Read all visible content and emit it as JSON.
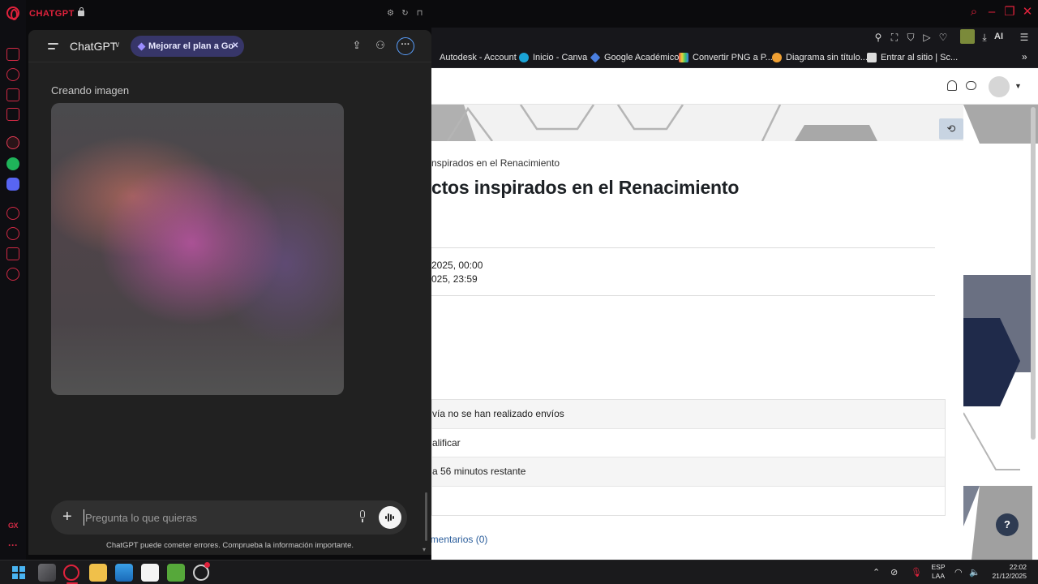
{
  "topbar": {
    "app_title": "CHATGPT"
  },
  "bookmarks": [
    {
      "label": "Autodesk - Account",
      "color": "#2a2a2a"
    },
    {
      "label": "Inicio - Canva",
      "color": "#1aa3d6"
    },
    {
      "label": "Google Académico",
      "color": "#4a7fe0"
    },
    {
      "label": "Convertir PNG a P...",
      "color": "#e8b23a"
    },
    {
      "label": "Diagrama sin título...",
      "color": "#f0a033"
    },
    {
      "label": "Entrar al sitio | Sc...",
      "color": "#dcdcdc"
    }
  ],
  "browser_toolbar": {
    "ai_label": "AI"
  },
  "webpage": {
    "breadcrumb": "nspirados en el Renacimiento",
    "title": "ctos inspirados en el Renacimiento",
    "dates": [
      "2025, 00:00",
      "025, 23:59"
    ],
    "status_rows": [
      "vía no se han realizado envíos",
      "alificar",
      "a 56 minutos restante",
      ""
    ],
    "comments_link": "omentarios (0)",
    "help_label": "?"
  },
  "chat": {
    "model_name": "ChatGPT",
    "upgrade_pill": "Mejorar el plan a Go",
    "creating_label": "Creando imagen",
    "composer_placeholder": "Pregunta lo que quieras",
    "disclaimer": "ChatGPT puede cometer errores. Comprueba la información importante."
  },
  "taskbar": {
    "language": "ESP",
    "language_region": "LAA",
    "time": "22:02",
    "date": "21/12/2025"
  },
  "colors": {
    "opera_red": "#e0223c",
    "chat_bg": "#212121",
    "upgrade_pill_bg": "#373669"
  }
}
